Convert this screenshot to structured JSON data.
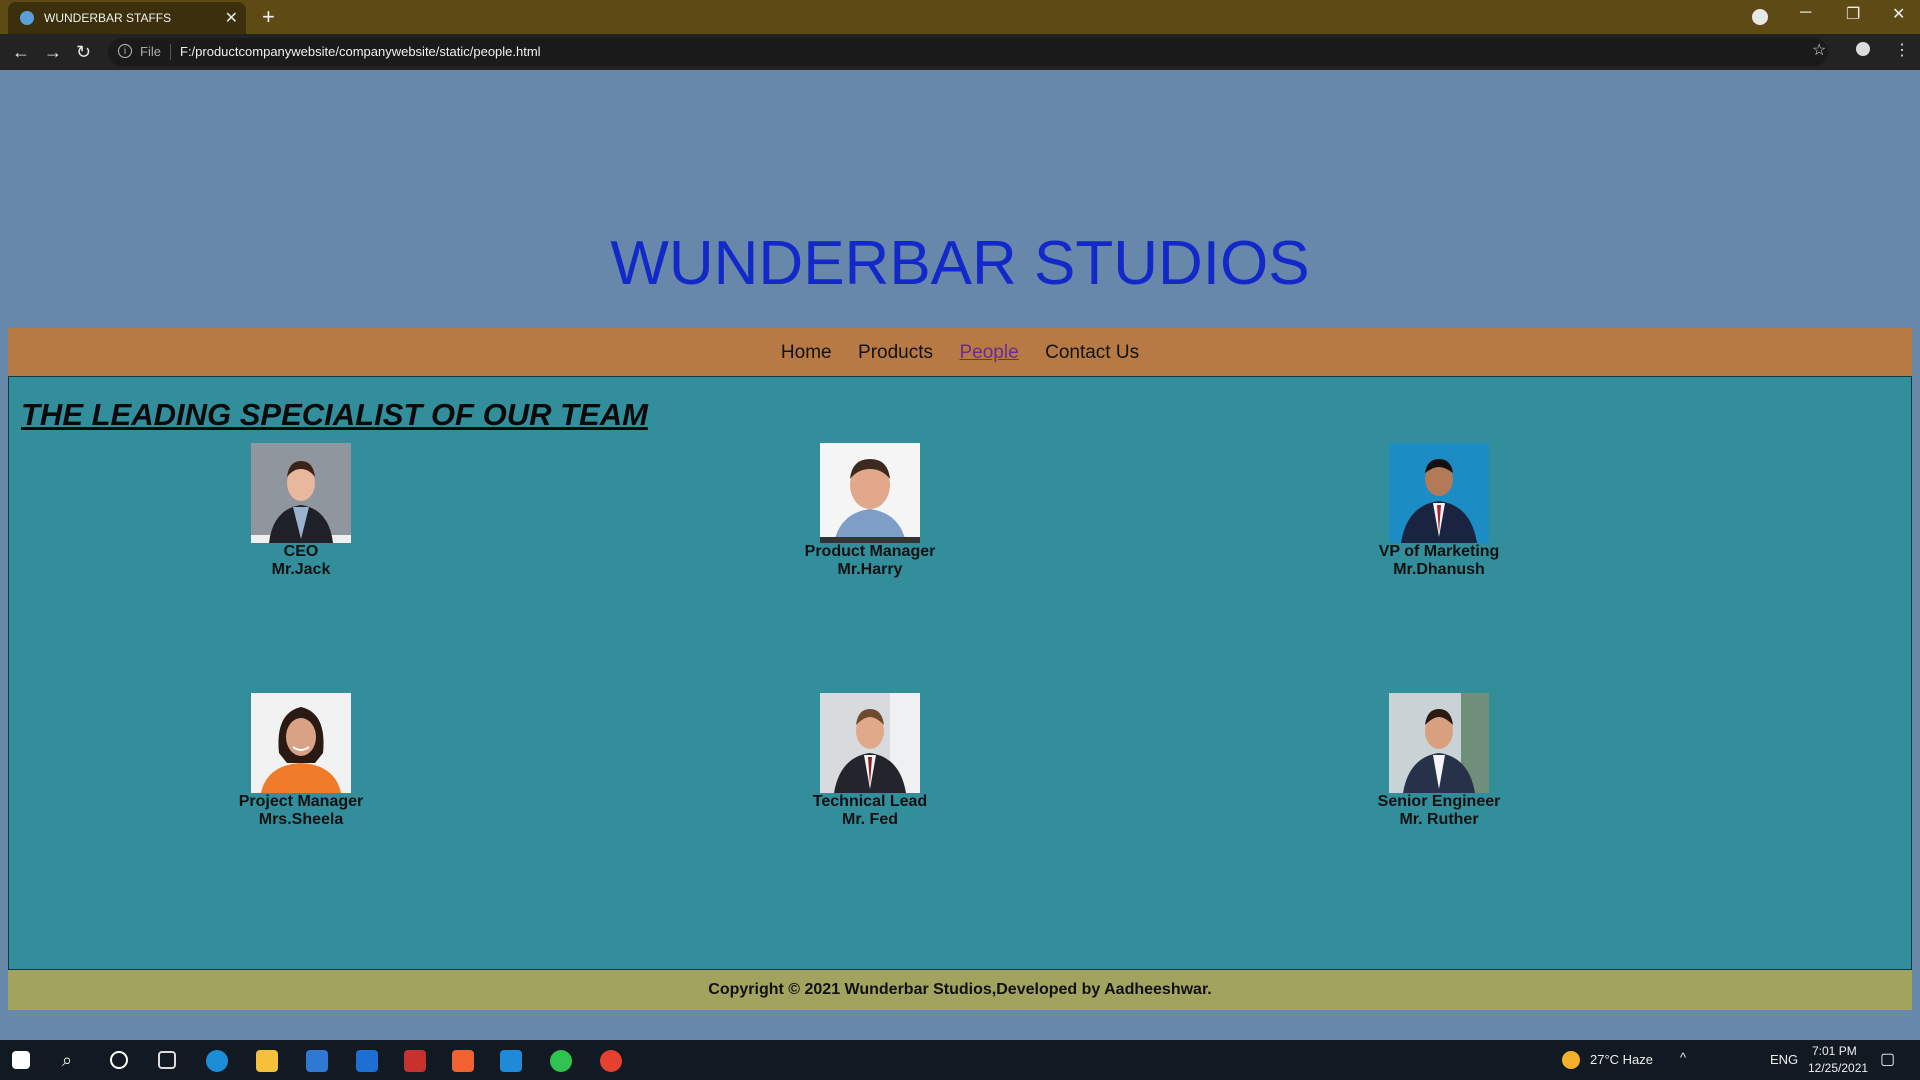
{
  "browser": {
    "tab_title": "WUNDERBAR STAFFS",
    "tab_close": "✕",
    "new_tab": "+",
    "file_label": "File",
    "url": "F:/productcompanywebsite/companywebsite/static/people.html",
    "accent": "#5e4a14"
  },
  "site": {
    "title": "WUNDERBAR STAFFS",
    "brand": "WUNDERBAR STUDIOS",
    "nav": [
      {
        "label": "Home"
      },
      {
        "label": "Products"
      },
      {
        "label": "People",
        "active": true
      },
      {
        "label": "Contact Us"
      }
    ],
    "heading": "THE LEADING SPECIALIST OF OUR TEAM",
    "people": [
      {
        "role": "CEO",
        "name": "Mr.Jack"
      },
      {
        "role": "Product Manager",
        "name": "Mr.Harry"
      },
      {
        "role": "VP of Marketing",
        "name": "Mr.Dhanush"
      },
      {
        "role": "Project Manager",
        "name": "Mrs.Sheela"
      },
      {
        "role": "Technical Lead",
        "name": "Mr. Fed"
      },
      {
        "role": "Senior Engineer",
        "name": "Mr. Ruther"
      }
    ],
    "footer": "Copyright © 2021 Wunderbar Studios,Developed by Aadheeshwar."
  },
  "taskbar": {
    "weather": "27°C  Haze",
    "lang": "ENG",
    "time": "7:01 PM",
    "date": "12/25/2021"
  },
  "colors": {
    "brand_blue": "#1328c8",
    "nav_bg": "#b87a45",
    "content_bg": "#338e9c",
    "footer_bg": "#a2a35e",
    "header_bg": "#6888ab"
  }
}
